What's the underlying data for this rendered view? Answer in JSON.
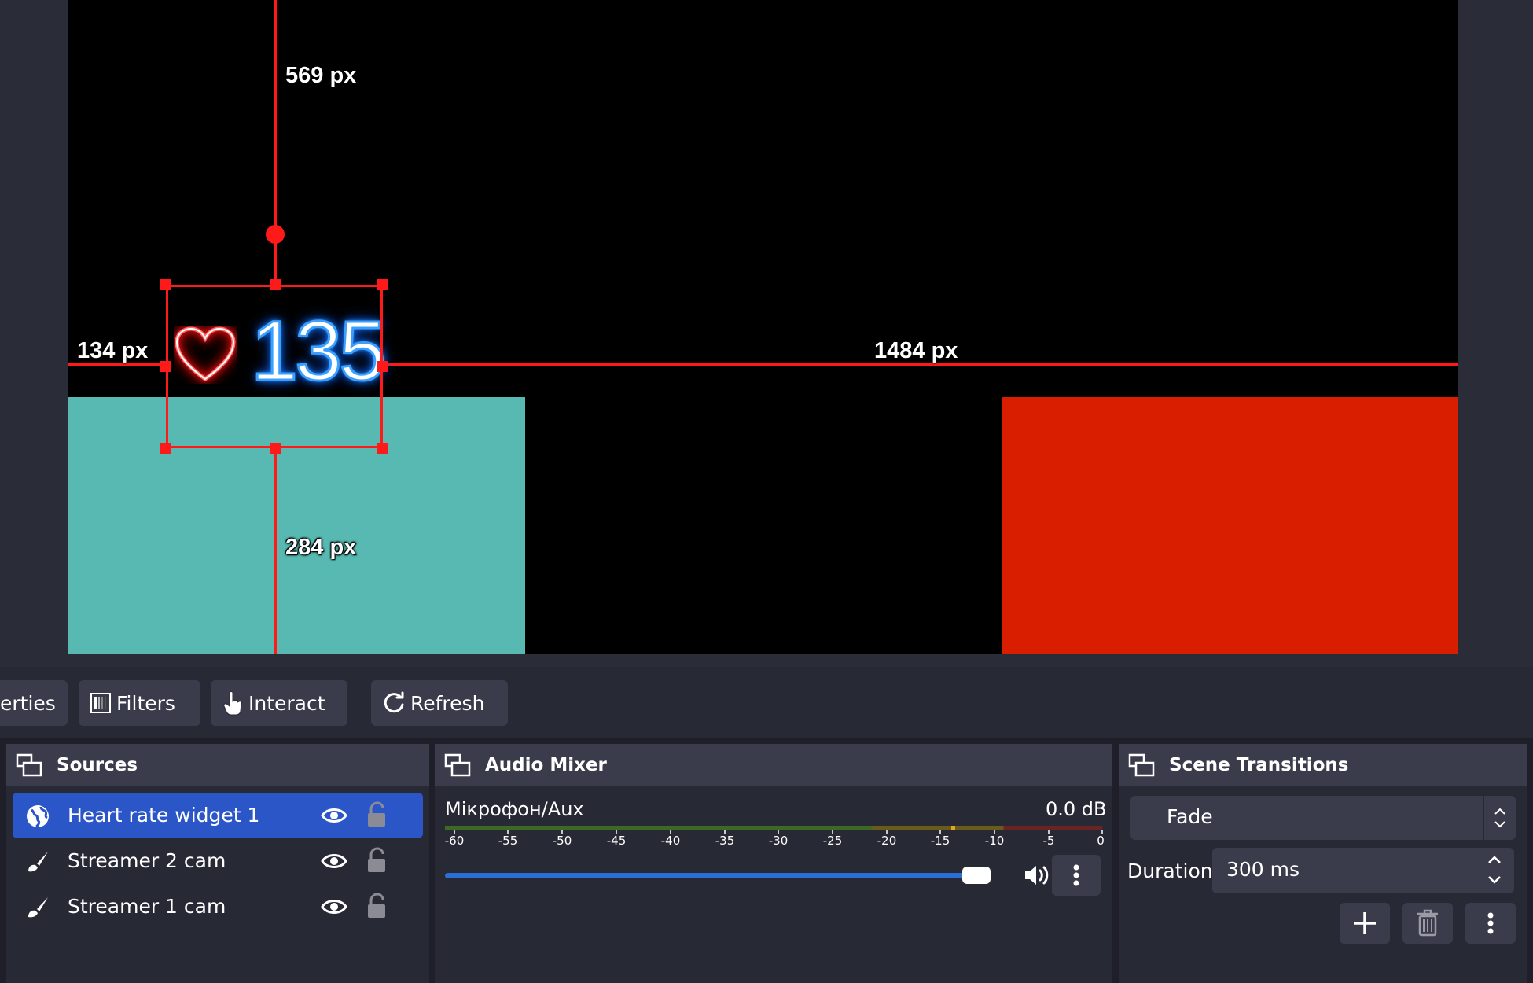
{
  "preview": {
    "measurements": {
      "top": "569 px",
      "left": "134 px",
      "right": "1484 px",
      "bottom": "284 px"
    },
    "widget": {
      "heart_rate": "135"
    },
    "colors": {
      "canvas": "#000000",
      "teal_source": "#58b9b2",
      "red_source": "#d91e00",
      "guides": "#ff1a1a",
      "heart": "#ff2a2a",
      "digits_glow": "#1a7bff"
    }
  },
  "toolbar": {
    "properties_label": "erties",
    "filters_label": "Filters",
    "interact_label": "Interact",
    "refresh_label": "Refresh"
  },
  "sources": {
    "title": "Sources",
    "items": [
      {
        "name": "Heart rate widget 1",
        "icon": "globe-icon",
        "selected": true
      },
      {
        "name": "Streamer 2 cam",
        "icon": "brush-icon",
        "selected": false
      },
      {
        "name": "Streamer 1 cam",
        "icon": "brush-icon",
        "selected": false
      }
    ]
  },
  "audio_mixer": {
    "title": "Audio Mixer",
    "channel": {
      "name": "Мікрофон/Aux",
      "level": "0.0 dB",
      "volume_fraction": 0.94
    },
    "scale_ticks": [
      "-60",
      "-55",
      "-50",
      "-45",
      "-40",
      "-35",
      "-30",
      "-25",
      "-20",
      "-15",
      "-10",
      "-5",
      "0"
    ]
  },
  "scene_transitions": {
    "title": "Scene Transitions",
    "transition": "Fade",
    "duration_label": "Duration",
    "duration_value": "300 ms"
  }
}
